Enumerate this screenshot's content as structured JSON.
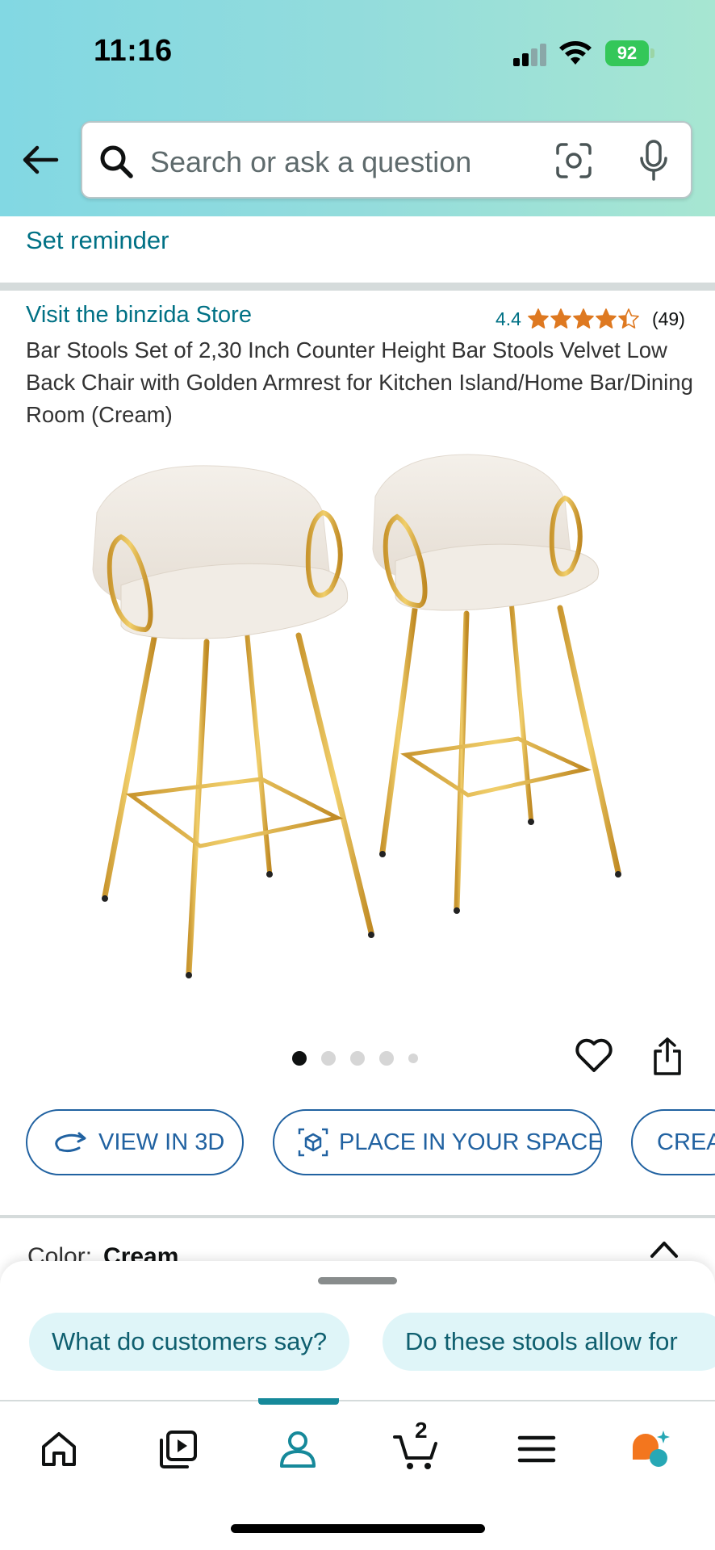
{
  "status_bar": {
    "time": "11:16",
    "battery": "92"
  },
  "search": {
    "placeholder": "Search or ask a question"
  },
  "reminder": {
    "label": "Set reminder"
  },
  "product": {
    "store_link": "Visit the binzida Store",
    "rating_value": "4.4",
    "rating_stars": 4.4,
    "rating_count": "(49)",
    "title": "Bar Stools Set of 2,30 Inch Counter Height Bar Stools Velvet Low Back Chair with Golden Armrest for Kitchen Island/Home Bar/Dining Room (Cream)",
    "image_pages": 5,
    "image_page_active": 1
  },
  "actions": {
    "view_3d": "VIEW IN 3D",
    "place_space": "PLACE IN YOUR SPACE",
    "create": "CREAT"
  },
  "color_selector": {
    "label": "Color:",
    "value": "Cream"
  },
  "suggestions": {
    "chips": [
      "What do customers say?",
      "Do these stools allow for"
    ]
  },
  "bottom_nav": {
    "items": [
      "home-icon",
      "video-icon",
      "account-icon",
      "cart-icon",
      "menu-icon",
      "rufus-icon"
    ],
    "active": "account-icon",
    "cart_count": "2"
  },
  "colors": {
    "link": "#007185",
    "pill_blue": "#2162a1",
    "star": "#de7921",
    "chip_bg": "#dff5f8",
    "active_nav": "#16899a"
  }
}
